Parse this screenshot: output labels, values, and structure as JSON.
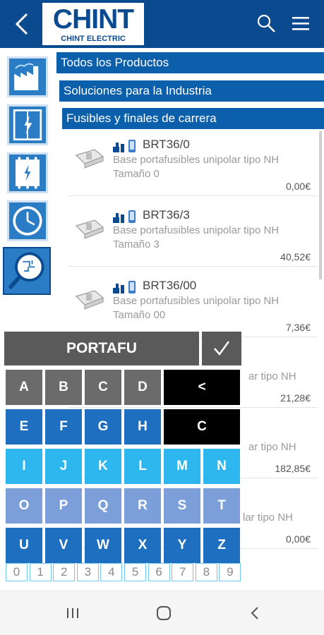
{
  "header": {
    "logo_main": "CHINT",
    "logo_sub": "CHINT ELECTRIC",
    "icons": [
      "back-icon",
      "search-icon",
      "hamburger-menu-icon"
    ]
  },
  "sidebar": {
    "items": [
      {
        "icon": "factory-icon"
      },
      {
        "icon": "electrical-cabinet-icon"
      },
      {
        "icon": "circuit-breaker-icon"
      },
      {
        "icon": "clock-icon"
      },
      {
        "icon": "magnifier-circuit-icon"
      }
    ]
  },
  "breadcrumbs": [
    {
      "label": "Todos los Productos"
    },
    {
      "label": "Soluciones para la Industria"
    },
    {
      "label": "Fusibles y finales de carrera"
    }
  ],
  "products": [
    {
      "code": "BRT36/0",
      "desc_line1": "Base portafusibles unipolar tipo NH",
      "desc_line2": "Tamaño 0",
      "price": "0,00€"
    },
    {
      "code": "BRT36/3",
      "desc_line1": "Base portafusibles unipolar tipo NH",
      "desc_line2": "Tamaño 3",
      "price": "40,52€"
    },
    {
      "code": "BRT36/00",
      "desc_line1": "Base portafusibles unipolar tipo NH",
      "desc_line2": "Tamaño 00",
      "price": "7,36€"
    },
    {
      "code": "",
      "desc_line1": "ar tipo NH",
      "desc_line2": "",
      "price": "21,28€"
    },
    {
      "code": "",
      "desc_line1": "ar tipo NH",
      "desc_line2": "",
      "price": "182,85€"
    },
    {
      "code": "",
      "desc_line1": "lar tipo NH",
      "desc_line2": "",
      "price": "0,00€"
    }
  ],
  "keyboard": {
    "input_value": "PORTAFU",
    "confirm": "✓",
    "row1": [
      "A",
      "B",
      "C",
      "D"
    ],
    "backspace": "<",
    "row2": [
      "E",
      "F",
      "G",
      "H"
    ],
    "clear": "C",
    "row3": [
      "I",
      "J",
      "K",
      "L",
      "M",
      "N"
    ],
    "row4": [
      "O",
      "P",
      "Q",
      "R",
      "S",
      "T"
    ],
    "row5": [
      "U",
      "V",
      "W",
      "X",
      "Y",
      "Z"
    ],
    "digits": [
      "0",
      "1",
      "2",
      "3",
      "4",
      "5",
      "6",
      "7",
      "8",
      "9"
    ],
    "colors": {
      "row1": "#6b6b6b",
      "row2": "#1f6fc0",
      "row3": "#2eb7ee",
      "row4": "#7c9fda",
      "row5": "#1f6fc0",
      "special": "#000000"
    }
  },
  "navbar": {
    "icons": [
      "recent-apps-icon",
      "home-icon",
      "back-nav-icon"
    ]
  },
  "colors": {
    "primary": "#0b4a8f",
    "crumb": "#0b5fab"
  }
}
